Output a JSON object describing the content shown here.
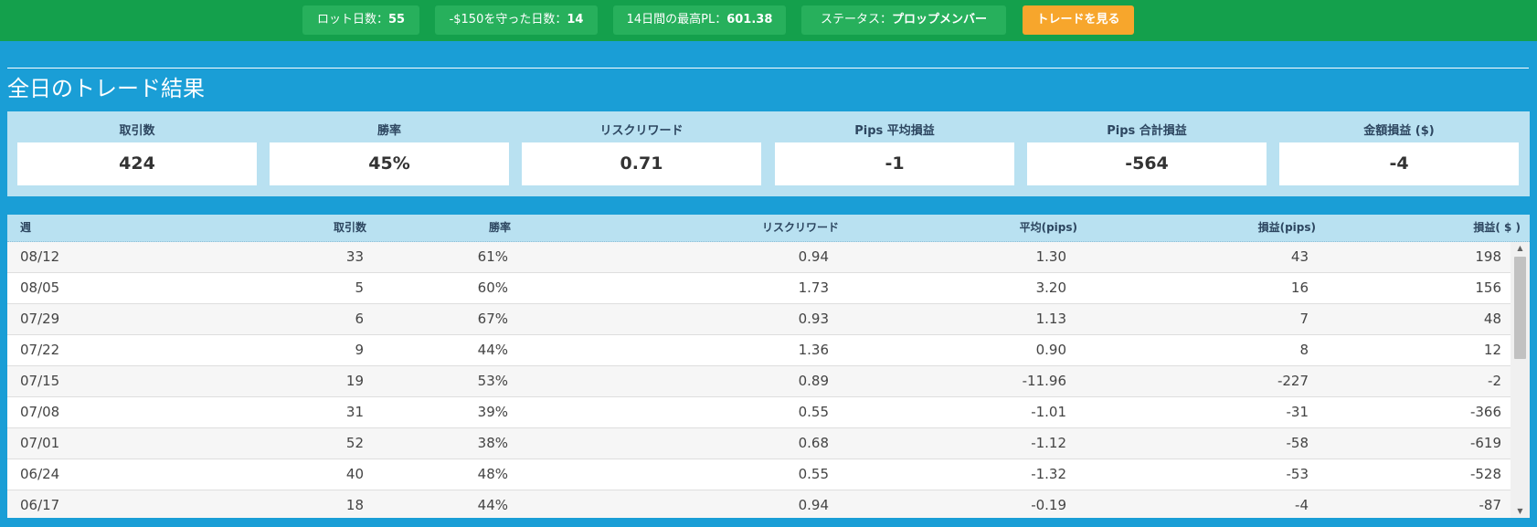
{
  "topbar": {
    "lot_days_label": "ロット日数：",
    "lot_days_value": "55",
    "protect_days_label": "-$150を守った日数：",
    "protect_days_value": "14",
    "max_pl_label": "14日間の最高PL：",
    "max_pl_value": "601.38",
    "status_label": "ステータス：",
    "status_value": "プロップメンバー",
    "view_trades_label": "トレードを見る"
  },
  "page_title": "全日のトレード結果",
  "summary": {
    "metrics": [
      {
        "label": "取引数",
        "value": "424"
      },
      {
        "label": "勝率",
        "value": "45%"
      },
      {
        "label": "リスクリワード",
        "value": "0.71"
      },
      {
        "label": "Pips 平均損益",
        "value": "-1"
      },
      {
        "label": "Pips 合計損益",
        "value": "-564"
      },
      {
        "label": "金額損益 ($)",
        "value": "-4"
      }
    ]
  },
  "table": {
    "columns": [
      "週",
      "取引数",
      "勝率",
      "リスクリワード",
      "平均(pips)",
      "損益(pips)",
      "損益( $ )"
    ],
    "rows": [
      [
        "08/12",
        "33",
        "61%",
        "0.94",
        "1.30",
        "43",
        "198"
      ],
      [
        "08/05",
        "5",
        "60%",
        "1.73",
        "3.20",
        "16",
        "156"
      ],
      [
        "07/29",
        "6",
        "67%",
        "0.93",
        "1.13",
        "7",
        "48"
      ],
      [
        "07/22",
        "9",
        "44%",
        "1.36",
        "0.90",
        "8",
        "12"
      ],
      [
        "07/15",
        "19",
        "53%",
        "0.89",
        "-11.96",
        "-227",
        "-2"
      ],
      [
        "07/08",
        "31",
        "39%",
        "0.55",
        "-1.01",
        "-31",
        "-366"
      ],
      [
        "07/01",
        "52",
        "38%",
        "0.68",
        "-1.12",
        "-58",
        "-619"
      ],
      [
        "06/24",
        "40",
        "48%",
        "0.55",
        "-1.32",
        "-53",
        "-528"
      ],
      [
        "06/17",
        "18",
        "44%",
        "0.94",
        "-0.19",
        "-4",
        "-87"
      ]
    ]
  },
  "icons": {
    "scroll_up": "scroll-up-arrow-icon",
    "scroll_down": "scroll-down-arrow-icon"
  },
  "colors": {
    "topbar_bg": "#14a04c",
    "pill_bg": "#27b05c",
    "cta_bg": "#f7a62c",
    "page_bg": "#1a9ed6",
    "summary_bg": "#b9e1f1"
  }
}
